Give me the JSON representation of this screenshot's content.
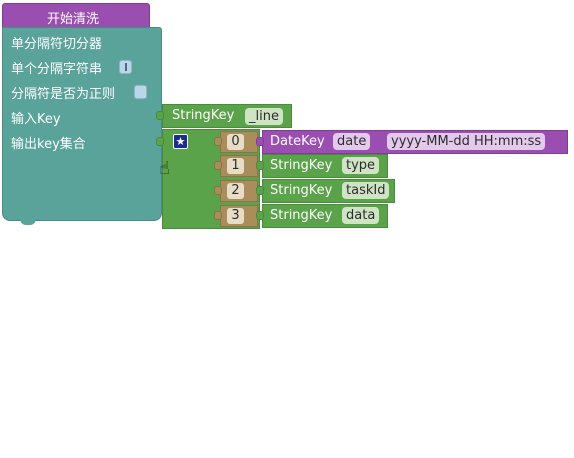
{
  "header": {
    "title": "开始清洗"
  },
  "main": {
    "row1": "单分隔符切分器",
    "row2": "单个分隔字符串",
    "row3": "分隔符是否为正则",
    "row4": "输入Key",
    "row5": "输出key集合"
  },
  "input_key": {
    "label": "StringKey",
    "value": "_line"
  },
  "outputs": [
    {
      "index": "0",
      "label": "DateKey",
      "value": "date",
      "format": "yyyy-MM-dd HH:mm:ss"
    },
    {
      "index": "1",
      "label": "StringKey",
      "value": "type"
    },
    {
      "index": "2",
      "label": "StringKey",
      "value": "taskId"
    },
    {
      "index": "3",
      "label": "StringKey",
      "value": "data"
    }
  ],
  "icons": {
    "gear": "star-settings-icon",
    "cursor": "hand-cursor-icon"
  }
}
